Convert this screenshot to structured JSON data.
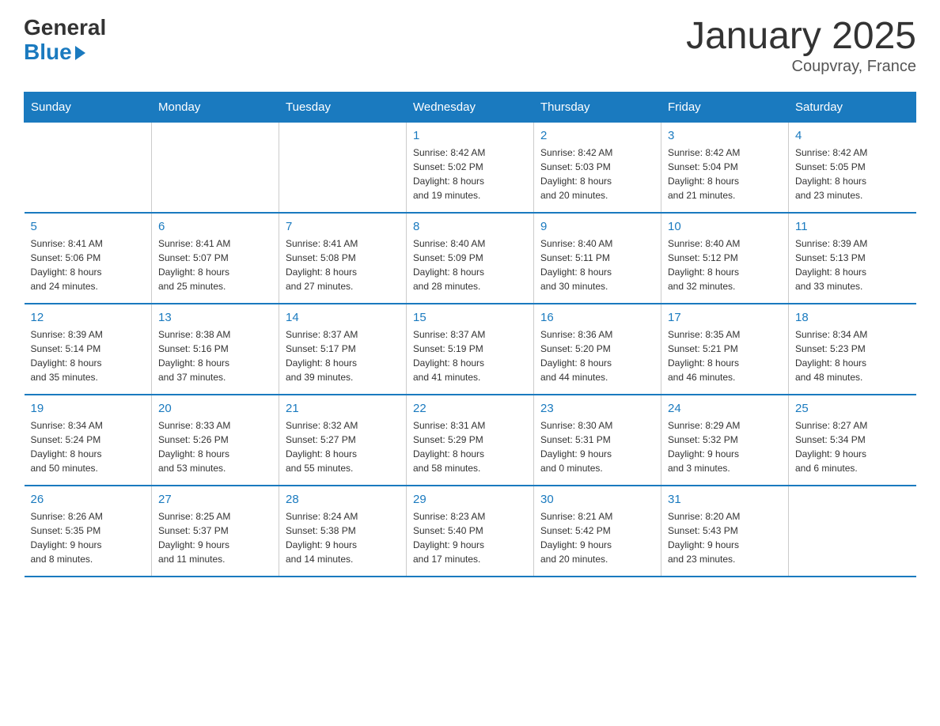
{
  "logo": {
    "general": "General",
    "blue": "Blue"
  },
  "title": "January 2025",
  "subtitle": "Coupvray, France",
  "weekdays": [
    "Sunday",
    "Monday",
    "Tuesday",
    "Wednesday",
    "Thursday",
    "Friday",
    "Saturday"
  ],
  "weeks": [
    [
      {
        "day": "",
        "info": ""
      },
      {
        "day": "",
        "info": ""
      },
      {
        "day": "",
        "info": ""
      },
      {
        "day": "1",
        "info": "Sunrise: 8:42 AM\nSunset: 5:02 PM\nDaylight: 8 hours\nand 19 minutes."
      },
      {
        "day": "2",
        "info": "Sunrise: 8:42 AM\nSunset: 5:03 PM\nDaylight: 8 hours\nand 20 minutes."
      },
      {
        "day": "3",
        "info": "Sunrise: 8:42 AM\nSunset: 5:04 PM\nDaylight: 8 hours\nand 21 minutes."
      },
      {
        "day": "4",
        "info": "Sunrise: 8:42 AM\nSunset: 5:05 PM\nDaylight: 8 hours\nand 23 minutes."
      }
    ],
    [
      {
        "day": "5",
        "info": "Sunrise: 8:41 AM\nSunset: 5:06 PM\nDaylight: 8 hours\nand 24 minutes."
      },
      {
        "day": "6",
        "info": "Sunrise: 8:41 AM\nSunset: 5:07 PM\nDaylight: 8 hours\nand 25 minutes."
      },
      {
        "day": "7",
        "info": "Sunrise: 8:41 AM\nSunset: 5:08 PM\nDaylight: 8 hours\nand 27 minutes."
      },
      {
        "day": "8",
        "info": "Sunrise: 8:40 AM\nSunset: 5:09 PM\nDaylight: 8 hours\nand 28 minutes."
      },
      {
        "day": "9",
        "info": "Sunrise: 8:40 AM\nSunset: 5:11 PM\nDaylight: 8 hours\nand 30 minutes."
      },
      {
        "day": "10",
        "info": "Sunrise: 8:40 AM\nSunset: 5:12 PM\nDaylight: 8 hours\nand 32 minutes."
      },
      {
        "day": "11",
        "info": "Sunrise: 8:39 AM\nSunset: 5:13 PM\nDaylight: 8 hours\nand 33 minutes."
      }
    ],
    [
      {
        "day": "12",
        "info": "Sunrise: 8:39 AM\nSunset: 5:14 PM\nDaylight: 8 hours\nand 35 minutes."
      },
      {
        "day": "13",
        "info": "Sunrise: 8:38 AM\nSunset: 5:16 PM\nDaylight: 8 hours\nand 37 minutes."
      },
      {
        "day": "14",
        "info": "Sunrise: 8:37 AM\nSunset: 5:17 PM\nDaylight: 8 hours\nand 39 minutes."
      },
      {
        "day": "15",
        "info": "Sunrise: 8:37 AM\nSunset: 5:19 PM\nDaylight: 8 hours\nand 41 minutes."
      },
      {
        "day": "16",
        "info": "Sunrise: 8:36 AM\nSunset: 5:20 PM\nDaylight: 8 hours\nand 44 minutes."
      },
      {
        "day": "17",
        "info": "Sunrise: 8:35 AM\nSunset: 5:21 PM\nDaylight: 8 hours\nand 46 minutes."
      },
      {
        "day": "18",
        "info": "Sunrise: 8:34 AM\nSunset: 5:23 PM\nDaylight: 8 hours\nand 48 minutes."
      }
    ],
    [
      {
        "day": "19",
        "info": "Sunrise: 8:34 AM\nSunset: 5:24 PM\nDaylight: 8 hours\nand 50 minutes."
      },
      {
        "day": "20",
        "info": "Sunrise: 8:33 AM\nSunset: 5:26 PM\nDaylight: 8 hours\nand 53 minutes."
      },
      {
        "day": "21",
        "info": "Sunrise: 8:32 AM\nSunset: 5:27 PM\nDaylight: 8 hours\nand 55 minutes."
      },
      {
        "day": "22",
        "info": "Sunrise: 8:31 AM\nSunset: 5:29 PM\nDaylight: 8 hours\nand 58 minutes."
      },
      {
        "day": "23",
        "info": "Sunrise: 8:30 AM\nSunset: 5:31 PM\nDaylight: 9 hours\nand 0 minutes."
      },
      {
        "day": "24",
        "info": "Sunrise: 8:29 AM\nSunset: 5:32 PM\nDaylight: 9 hours\nand 3 minutes."
      },
      {
        "day": "25",
        "info": "Sunrise: 8:27 AM\nSunset: 5:34 PM\nDaylight: 9 hours\nand 6 minutes."
      }
    ],
    [
      {
        "day": "26",
        "info": "Sunrise: 8:26 AM\nSunset: 5:35 PM\nDaylight: 9 hours\nand 8 minutes."
      },
      {
        "day": "27",
        "info": "Sunrise: 8:25 AM\nSunset: 5:37 PM\nDaylight: 9 hours\nand 11 minutes."
      },
      {
        "day": "28",
        "info": "Sunrise: 8:24 AM\nSunset: 5:38 PM\nDaylight: 9 hours\nand 14 minutes."
      },
      {
        "day": "29",
        "info": "Sunrise: 8:23 AM\nSunset: 5:40 PM\nDaylight: 9 hours\nand 17 minutes."
      },
      {
        "day": "30",
        "info": "Sunrise: 8:21 AM\nSunset: 5:42 PM\nDaylight: 9 hours\nand 20 minutes."
      },
      {
        "day": "31",
        "info": "Sunrise: 8:20 AM\nSunset: 5:43 PM\nDaylight: 9 hours\nand 23 minutes."
      },
      {
        "day": "",
        "info": ""
      }
    ]
  ]
}
